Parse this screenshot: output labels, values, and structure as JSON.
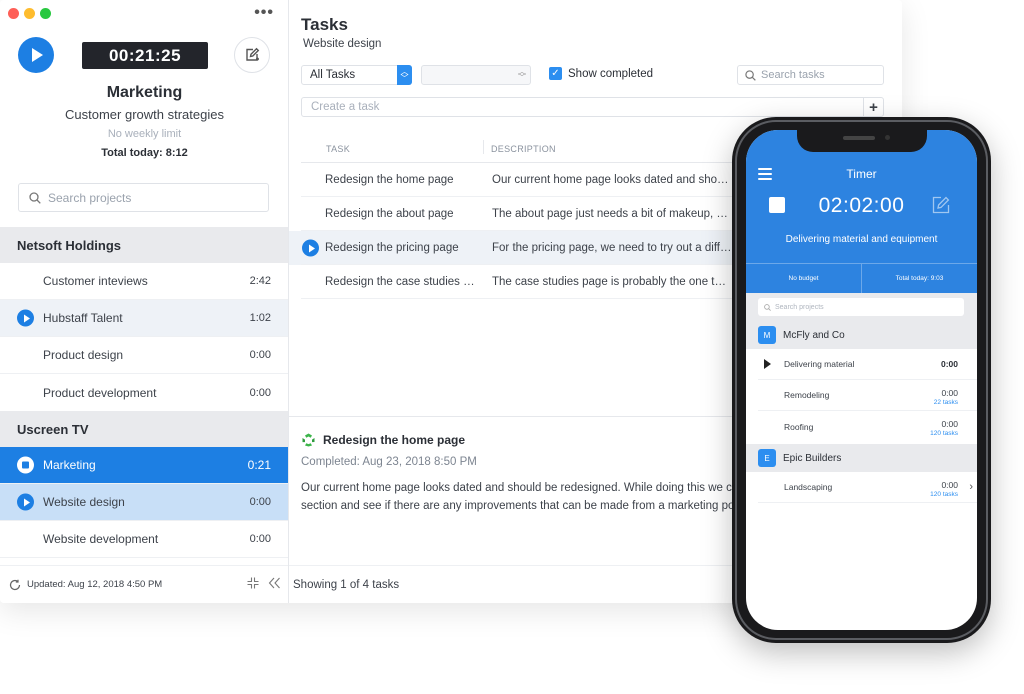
{
  "colors": {
    "accent": "#1d7fe3",
    "active_row": "#1d7fe3",
    "selected_row": "#c8dff7",
    "mac_close": "#fe5f57",
    "mac_minimize": "#febc2e",
    "mac_zoom": "#28c840",
    "timer_bg": "#23252b",
    "phone_header": "#2d83e0"
  },
  "sidebar": {
    "timer": "00:21:25",
    "project_title": "Marketing",
    "project_subtitle": "Customer growth strategies",
    "weekly_limit": "No weekly limit",
    "total_today": "Total today: 8:12",
    "search_placeholder": "Search projects",
    "groups": [
      {
        "name": "Netsoft Holdings",
        "items": [
          {
            "name": "Customer inteviews",
            "time": "2:42"
          },
          {
            "name": "Hubstaff Talent",
            "time": "1:02"
          },
          {
            "name": "Product design",
            "time": "0:00"
          },
          {
            "name": "Product development",
            "time": "0:00"
          }
        ]
      },
      {
        "name": "Uscreen TV",
        "items": [
          {
            "name": "Marketing",
            "time": "0:21"
          },
          {
            "name": "Website design",
            "time": "0:00"
          },
          {
            "name": "Website development",
            "time": "0:00"
          }
        ]
      }
    ],
    "footer": {
      "updated": "Updated: Aug 12, 2018 4:50 PM"
    }
  },
  "main": {
    "title": "Tasks",
    "subtitle": "Website design",
    "filter_select": "All Tasks",
    "second_select": "",
    "show_completed_label": "Show completed",
    "show_completed_checked": true,
    "search_placeholder": "Search tasks",
    "create_placeholder": "Create a task",
    "add_label": "+",
    "columns": {
      "task": "TASK",
      "description": "DESCRIPTION"
    },
    "tasks": [
      {
        "name": "Redesign the home page",
        "description": "Our current home page looks dated and should be redesigned."
      },
      {
        "name": "Redesign the about page",
        "description": "The about page just needs a bit of makeup, because"
      },
      {
        "name": "Redesign the pricing page",
        "description": "For the pricing page, we need to try out a different"
      },
      {
        "name": "Redesign the case studies page",
        "description": "The case studies page is probably the one that needs"
      }
    ],
    "detail": {
      "title": "Redesign the home page",
      "completed": "Completed: Aug 23, 2018 8:50 PM",
      "line1": "Our current home page looks dated and should be redesigned. While doing this we can",
      "line2": "section and see if there are any improvements that can be made from a marketing point"
    },
    "footer": "Showing 1 of 4 tasks"
  },
  "phone": {
    "title": "Timer",
    "timer": "02:02:00",
    "description": "Delivering material and equipment",
    "budget": "No budget",
    "total_today": "Total today: 9:03",
    "search_placeholder": "Search projects",
    "groups": [
      {
        "badge": "M",
        "name": "McFly and Co",
        "items": [
          {
            "name": "Delivering material",
            "time": "0:00",
            "tasks": ""
          },
          {
            "name": "Remodeling",
            "time": "0:00",
            "tasks": "22 tasks"
          },
          {
            "name": "Roofing",
            "time": "0:00",
            "tasks": "120 tasks"
          }
        ]
      },
      {
        "badge": "E",
        "name": "Epic Builders",
        "items": [
          {
            "name": "Landscaping",
            "time": "0:00",
            "tasks": "120 tasks"
          }
        ]
      }
    ]
  }
}
